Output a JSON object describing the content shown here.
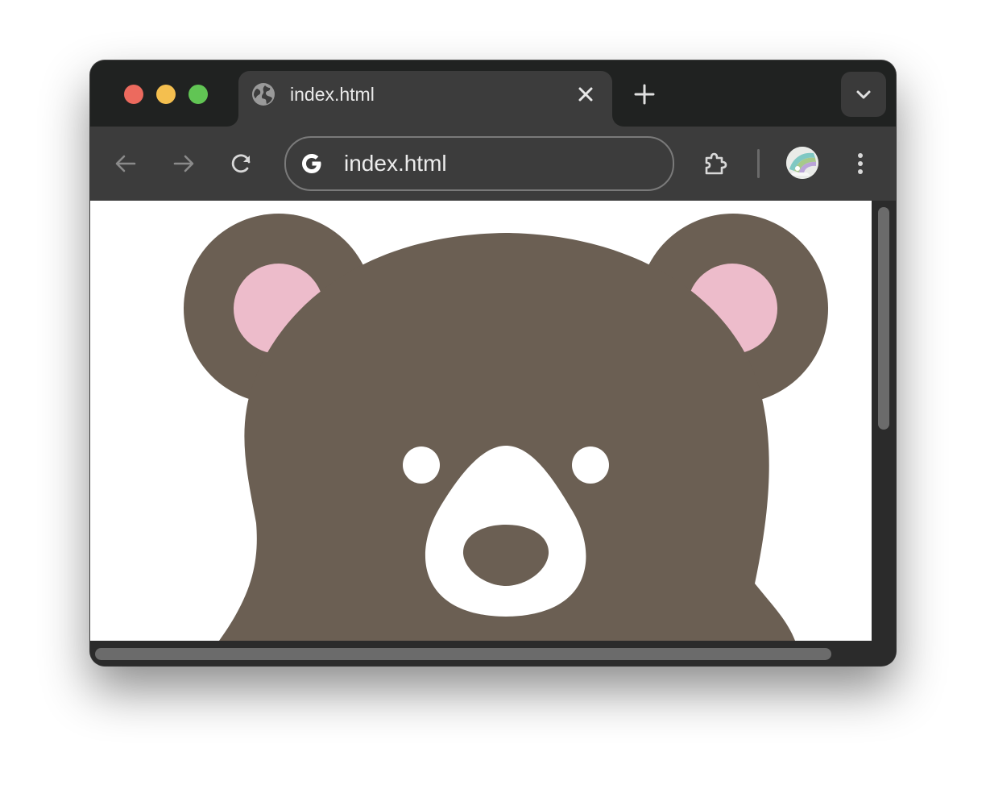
{
  "window": {
    "traffic_lights": {
      "close_color": "#ec6a5e",
      "minimize_color": "#f4bf4f",
      "maximize_color": "#61c554"
    }
  },
  "tabs": [
    {
      "title": "index.html",
      "icon": "globe-icon",
      "active": true
    }
  ],
  "tabstrip": {
    "new_tab_icon": "plus-icon",
    "tab_search_icon": "chevron-down-icon"
  },
  "toolbar": {
    "back_icon": "arrow-left-icon",
    "forward_icon": "arrow-right-icon",
    "reload_icon": "reload-icon",
    "address": "index.html",
    "search_engine_icon": "google-g-icon",
    "extensions_icon": "puzzle-icon",
    "profile_icon": "avatar",
    "menu_icon": "kebab-menu-icon"
  },
  "page": {
    "content": "bear-illustration",
    "colors": {
      "fur": "#6b5f53",
      "inner_ear": "#edbccb",
      "muzzle": "#ffffff",
      "nose": "#6b5f53",
      "eyes": "#ffffff"
    }
  }
}
